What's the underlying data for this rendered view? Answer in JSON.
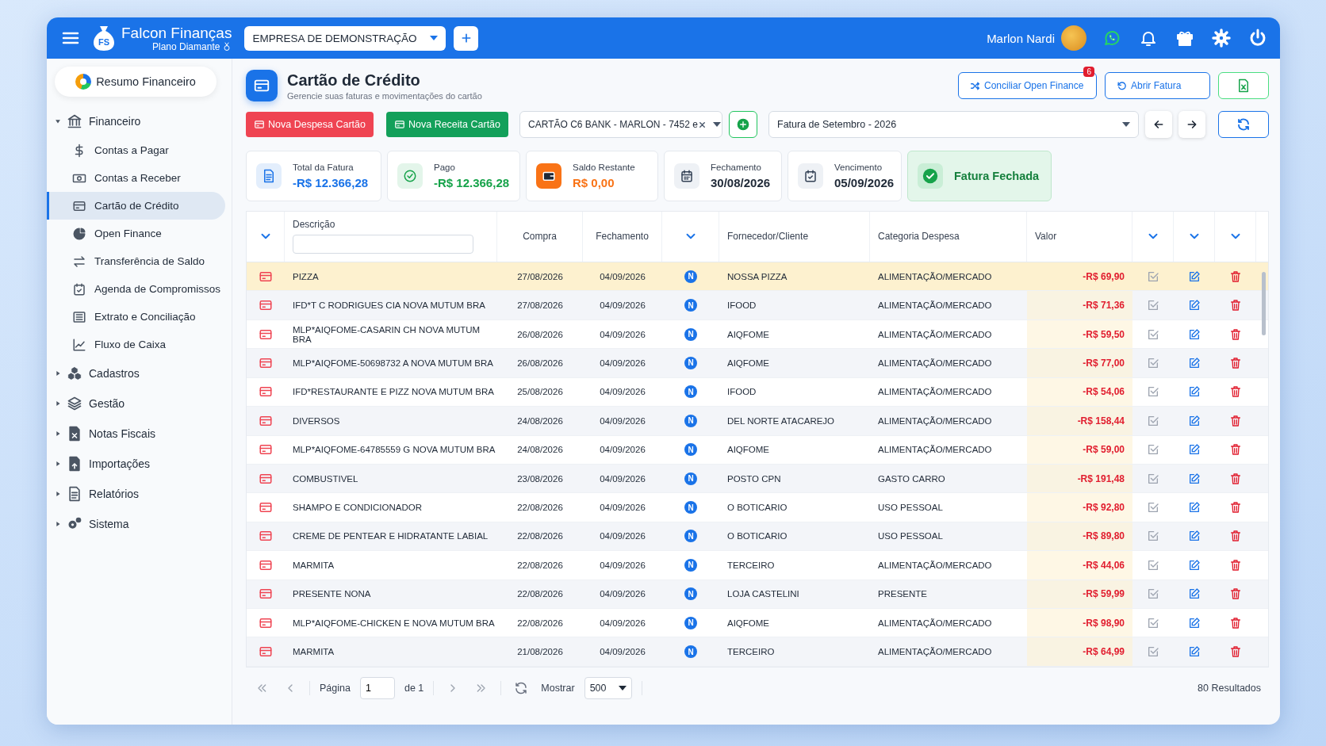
{
  "header": {
    "brand": "Falcon Finanças",
    "logo_text": "FS",
    "plan": "Plano Diamante",
    "company": "EMPRESA DE DEMONSTRAÇÃO",
    "user": "Marlon Nardi"
  },
  "sidebar": {
    "summary_button": "Resumo Financeiro",
    "groups": [
      {
        "label": "Financeiro",
        "expanded": true,
        "children": [
          {
            "label": "Contas a Pagar",
            "selected": false
          },
          {
            "label": "Contas a Receber",
            "selected": false
          },
          {
            "label": "Cartão de Crédito",
            "selected": true
          },
          {
            "label": "Open Finance",
            "selected": false
          },
          {
            "label": "Transferência de Saldo",
            "selected": false
          },
          {
            "label": "Agenda de Compromissos",
            "selected": false
          },
          {
            "label": "Extrato e Conciliação",
            "selected": false
          },
          {
            "label": "Fluxo de Caixa",
            "selected": false
          }
        ]
      },
      {
        "label": "Cadastros",
        "expanded": false
      },
      {
        "label": "Gestão",
        "expanded": false
      },
      {
        "label": "Notas Fiscais",
        "expanded": false
      },
      {
        "label": "Importações",
        "expanded": false
      },
      {
        "label": "Relatórios",
        "expanded": false
      },
      {
        "label": "Sistema",
        "expanded": false
      }
    ]
  },
  "page": {
    "title": "Cartão de Crédito",
    "subtitle": "Gerencie suas faturas e movimentações do cartão",
    "actions": [
      {
        "label": "Conciliar Open Finance",
        "badge": "6"
      },
      {
        "label": "Abrir Fatura"
      }
    ]
  },
  "toolbar": {
    "new_expense": "Nova Despesa Cartão",
    "new_income": "Nova Receita Cartão",
    "card_select": "CARTÃO C6 BANK - MARLON - 7452 e",
    "invoice_select": "Fatura de Setembro - 2026"
  },
  "cards": [
    {
      "label": "Total da Fatura",
      "value": "-R$ 12.366,28",
      "color": "#1a73e8"
    },
    {
      "label": "Pago",
      "value": "-R$ 12.366,28",
      "color": "#16a34a"
    },
    {
      "label": "Saldo Restante",
      "value": "R$ 0,00",
      "color": "#f97316"
    },
    {
      "label": "Fechamento",
      "value": "30/08/2026",
      "color": "#1f2937"
    },
    {
      "label": "Vencimento",
      "value": "05/09/2026",
      "color": "#1f2937"
    }
  ],
  "invoice_status": "Fatura Fechada",
  "table": {
    "columns": [
      {
        "kind": "toggle"
      },
      {
        "kind": "filter",
        "label": "Descrição"
      },
      {
        "kind": "text",
        "label": "Compra"
      },
      {
        "kind": "text",
        "label": "Fechamento"
      },
      {
        "kind": "toggle"
      },
      {
        "kind": "text",
        "label": "Fornecedor/Cliente"
      },
      {
        "kind": "text",
        "label": "Categoria Despesa"
      },
      {
        "kind": "text",
        "label": "Valor"
      },
      {
        "kind": "toggle"
      },
      {
        "kind": "toggle"
      },
      {
        "kind": "toggle"
      }
    ],
    "rows": [
      {
        "description": "PIZZA",
        "purchase": "27/08/2026",
        "closing": "04/09/2026",
        "flag": "N",
        "supplier": "NOSSA PIZZA",
        "category": "ALIMENTAÇÃO/MERCADO",
        "value": "-R$ 69,90",
        "selected": true
      },
      {
        "description": "IFD*T C RODRIGUES CIA NOVA MUTUM BRA",
        "purchase": "27/08/2026",
        "closing": "04/09/2026",
        "flag": "N",
        "supplier": "IFOOD",
        "category": "ALIMENTAÇÃO/MERCADO",
        "value": "-R$ 71,36",
        "selected": false
      },
      {
        "description": "MLP*AIQFOME-CASARIN CH NOVA MUTUM BRA",
        "purchase": "26/08/2026",
        "closing": "04/09/2026",
        "flag": "N",
        "supplier": "AIQFOME",
        "category": "ALIMENTAÇÃO/MERCADO",
        "value": "-R$ 59,50",
        "selected": false
      },
      {
        "description": "MLP*AIQFOME-50698732 A NOVA MUTUM BRA",
        "purchase": "26/08/2026",
        "closing": "04/09/2026",
        "flag": "N",
        "supplier": "AIQFOME",
        "category": "ALIMENTAÇÃO/MERCADO",
        "value": "-R$ 77,00",
        "selected": false
      },
      {
        "description": "IFD*RESTAURANTE E PIZZ NOVA MUTUM BRA",
        "purchase": "25/08/2026",
        "closing": "04/09/2026",
        "flag": "N",
        "supplier": "IFOOD",
        "category": "ALIMENTAÇÃO/MERCADO",
        "value": "-R$ 54,06",
        "selected": false
      },
      {
        "description": "DIVERSOS",
        "purchase": "24/08/2026",
        "closing": "04/09/2026",
        "flag": "N",
        "supplier": "DEL NORTE ATACAREJO",
        "category": "ALIMENTAÇÃO/MERCADO",
        "value": "-R$ 158,44",
        "selected": false
      },
      {
        "description": "MLP*AIQFOME-64785559 G NOVA MUTUM BRA",
        "purchase": "24/08/2026",
        "closing": "04/09/2026",
        "flag": "N",
        "supplier": "AIQFOME",
        "category": "ALIMENTAÇÃO/MERCADO",
        "value": "-R$ 59,00",
        "selected": false
      },
      {
        "description": "COMBUSTIVEL",
        "purchase": "23/08/2026",
        "closing": "04/09/2026",
        "flag": "N",
        "supplier": "POSTO CPN",
        "category": "GASTO CARRO",
        "value": "-R$ 191,48",
        "selected": false
      },
      {
        "description": "SHAMPO E CONDICIONADOR",
        "purchase": "22/08/2026",
        "closing": "04/09/2026",
        "flag": "N",
        "supplier": "O BOTICARIO",
        "category": "USO PESSOAL",
        "value": "-R$ 92,80",
        "selected": false
      },
      {
        "description": "CREME DE PENTEAR E HIDRATANTE LABIAL",
        "purchase": "22/08/2026",
        "closing": "04/09/2026",
        "flag": "N",
        "supplier": "O BOTICARIO",
        "category": "USO PESSOAL",
        "value": "-R$ 89,80",
        "selected": false
      },
      {
        "description": "MARMITA",
        "purchase": "22/08/2026",
        "closing": "04/09/2026",
        "flag": "N",
        "supplier": "TERCEIRO",
        "category": "ALIMENTAÇÃO/MERCADO",
        "value": "-R$ 44,06",
        "selected": false
      },
      {
        "description": "PRESENTE NONA",
        "purchase": "22/08/2026",
        "closing": "04/09/2026",
        "flag": "N",
        "supplier": "LOJA CASTELINI",
        "category": "PRESENTE",
        "value": "-R$ 59,99",
        "selected": false
      },
      {
        "description": "MLP*AIQFOME-CHICKEN E NOVA MUTUM BRA",
        "purchase": "22/08/2026",
        "closing": "04/09/2026",
        "flag": "N",
        "supplier": "AIQFOME",
        "category": "ALIMENTAÇÃO/MERCADO",
        "value": "-R$ 98,90",
        "selected": false
      },
      {
        "description": "MARMITA",
        "purchase": "21/08/2026",
        "closing": "04/09/2026",
        "flag": "N",
        "supplier": "TERCEIRO",
        "category": "ALIMENTAÇÃO/MERCADO",
        "value": "-R$ 64,99",
        "selected": false
      }
    ]
  },
  "pagination": {
    "page_label": "Página",
    "page": "1",
    "of": "de 1",
    "show_label": "Mostrar",
    "page_size": "500",
    "results": "80 Resultados"
  }
}
